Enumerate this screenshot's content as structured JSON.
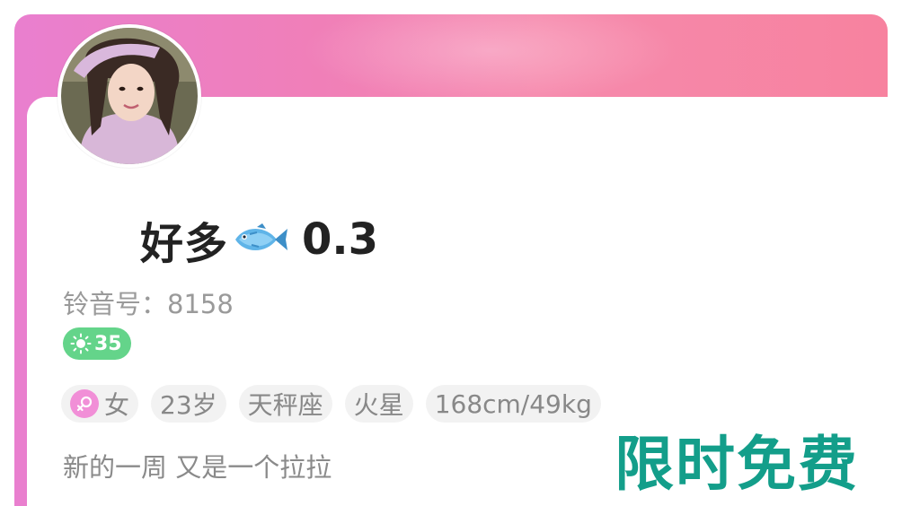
{
  "profile": {
    "name": "好多",
    "name_suffix": "0.3",
    "name_emoji": "fish-icon",
    "id_label": "铃音号：",
    "id_value": "8158",
    "level": "35",
    "bio": "新的一周  又是一个拉拉"
  },
  "tags": {
    "gender": "女",
    "age": "23岁",
    "zodiac": "天秤座",
    "planet": "火星",
    "body": "168cm/49kg"
  },
  "promo": {
    "label": "限时免费"
  },
  "colors": {
    "header_gradient_start": "#e97fcf",
    "header_gradient_end": "#f7829f",
    "level_badge": "#64d48a",
    "gender_badge": "#f18fd7",
    "promo_text": "#139e8a"
  }
}
